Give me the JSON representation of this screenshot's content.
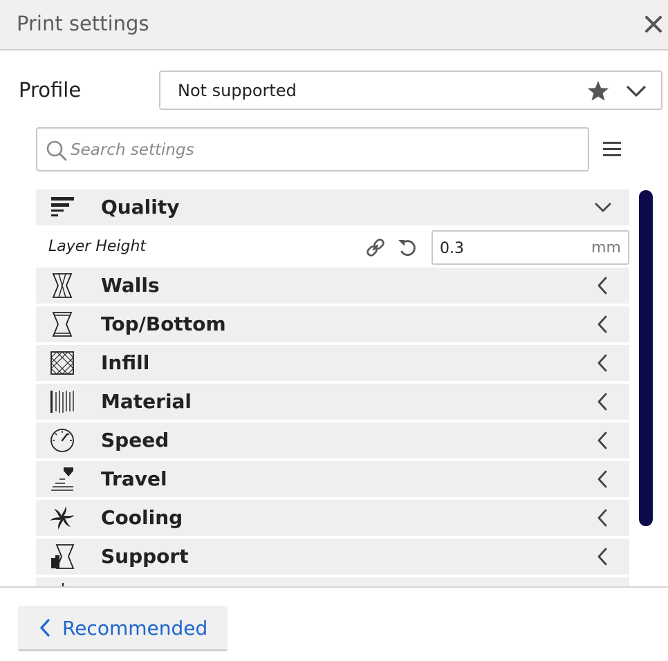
{
  "window": {
    "title": "Print settings",
    "close_icon": "close-icon"
  },
  "profile": {
    "label": "Profile",
    "value": "Not supported",
    "favorite_icon": "star-icon",
    "dropdown_icon": "chevron-down-icon"
  },
  "search": {
    "placeholder": "Search settings",
    "value": "",
    "icon": "search-icon",
    "menu_icon": "menu-icon"
  },
  "categories": [
    {
      "label": "Quality",
      "icon": "quality-icon",
      "expanded": true
    },
    {
      "label": "Walls",
      "icon": "walls-icon",
      "expanded": false
    },
    {
      "label": "Top/Bottom",
      "icon": "top-bottom-icon",
      "expanded": false
    },
    {
      "label": "Infill",
      "icon": "infill-icon",
      "expanded": false
    },
    {
      "label": "Material",
      "icon": "material-icon",
      "expanded": false
    },
    {
      "label": "Speed",
      "icon": "speed-icon",
      "expanded": false
    },
    {
      "label": "Travel",
      "icon": "travel-icon",
      "expanded": false
    },
    {
      "label": "Cooling",
      "icon": "cooling-icon",
      "expanded": false
    },
    {
      "label": "Support",
      "icon": "support-icon",
      "expanded": false
    }
  ],
  "quality_settings": [
    {
      "label": "Layer Height",
      "value": "0.3",
      "unit": "mm",
      "link_icon": "link-icon",
      "reset_icon": "reset-icon"
    }
  ],
  "footer": {
    "recommended_label": "Recommended",
    "back_icon": "chevron-left-icon"
  },
  "colors": {
    "accent": "#1e66d0",
    "scrollbar": "#0c0a4a",
    "category_bg": "#efefef",
    "titlebar_bg": "#f0f0f0"
  }
}
